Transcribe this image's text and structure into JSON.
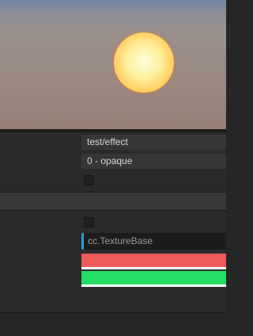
{
  "preview": {
    "background_top": "#6f87a8",
    "background_bottom": "#937f74",
    "sphere_color": "#ffef9a"
  },
  "properties": {
    "effect": "test/effect",
    "technique": "0 - opaque",
    "checkbox_1_checked": false,
    "checkbox_2_checked": false,
    "texture_placeholder": "cc.TextureBase",
    "color_1": "#ef5a5a",
    "color_2": "#25dc64"
  }
}
